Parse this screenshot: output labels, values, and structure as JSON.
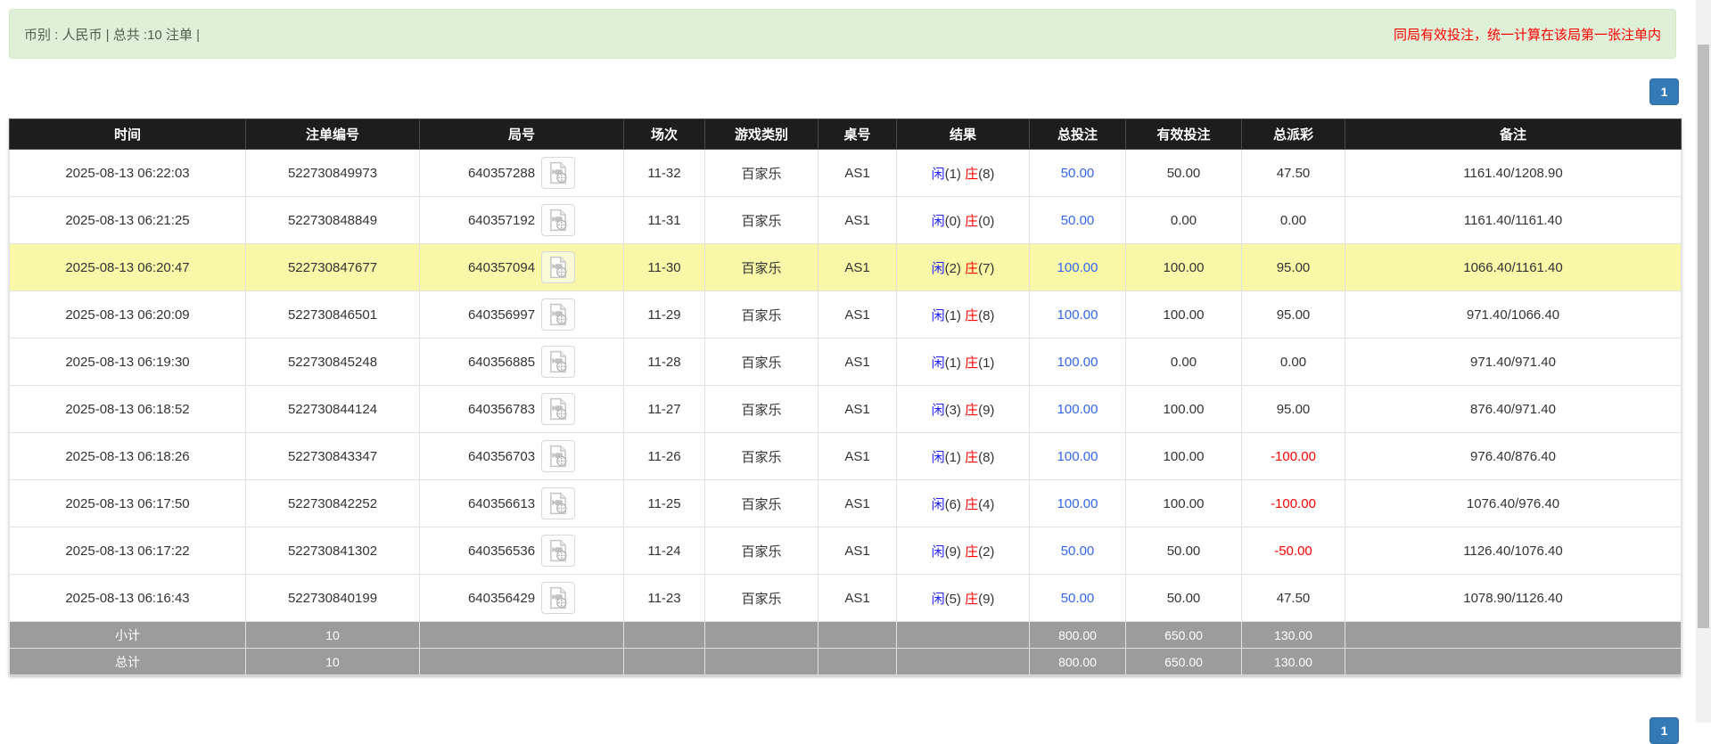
{
  "info_bar": {
    "left_text": "币别 : 人民币 | 总共 :10 注单 |",
    "right_text": "同局有效投注，统一计算在该局第一张注单内"
  },
  "pagination": {
    "page": "1"
  },
  "table": {
    "columns": [
      "时间",
      "注单编号",
      "局号",
      "场次",
      "游戏类别",
      "桌号",
      "结果",
      "总投注",
      "有效投注",
      "总派彩",
      "备注"
    ],
    "result_labels": {
      "player": "闲",
      "banker": "庄"
    },
    "video_icon": "video-replay-icon",
    "rows": [
      {
        "time": "2025-08-13 06:22:03",
        "bet_id": "522730849973",
        "round_id": "640357288",
        "session": "11-32",
        "game": "百家乐",
        "table_no": "AS1",
        "player": "1",
        "banker": "8",
        "total_bet": "50.00",
        "valid_bet": "50.00",
        "payout": "47.50",
        "remark": "1161.40/1208.90",
        "highlight": false
      },
      {
        "time": "2025-08-13 06:21:25",
        "bet_id": "522730848849",
        "round_id": "640357192",
        "session": "11-31",
        "game": "百家乐",
        "table_no": "AS1",
        "player": "0",
        "banker": "0",
        "total_bet": "50.00",
        "valid_bet": "0.00",
        "payout": "0.00",
        "remark": "1161.40/1161.40",
        "highlight": false
      },
      {
        "time": "2025-08-13 06:20:47",
        "bet_id": "522730847677",
        "round_id": "640357094",
        "session": "11-30",
        "game": "百家乐",
        "table_no": "AS1",
        "player": "2",
        "banker": "7",
        "total_bet": "100.00",
        "valid_bet": "100.00",
        "payout": "95.00",
        "remark": "1066.40/1161.40",
        "highlight": true
      },
      {
        "time": "2025-08-13 06:20:09",
        "bet_id": "522730846501",
        "round_id": "640356997",
        "session": "11-29",
        "game": "百家乐",
        "table_no": "AS1",
        "player": "1",
        "banker": "8",
        "total_bet": "100.00",
        "valid_bet": "100.00",
        "payout": "95.00",
        "remark": "971.40/1066.40",
        "highlight": false
      },
      {
        "time": "2025-08-13 06:19:30",
        "bet_id": "522730845248",
        "round_id": "640356885",
        "session": "11-28",
        "game": "百家乐",
        "table_no": "AS1",
        "player": "1",
        "banker": "1",
        "total_bet": "100.00",
        "valid_bet": "0.00",
        "payout": "0.00",
        "remark": "971.40/971.40",
        "highlight": false
      },
      {
        "time": "2025-08-13 06:18:52",
        "bet_id": "522730844124",
        "round_id": "640356783",
        "session": "11-27",
        "game": "百家乐",
        "table_no": "AS1",
        "player": "3",
        "banker": "9",
        "total_bet": "100.00",
        "valid_bet": "100.00",
        "payout": "95.00",
        "remark": "876.40/971.40",
        "highlight": false
      },
      {
        "time": "2025-08-13 06:18:26",
        "bet_id": "522730843347",
        "round_id": "640356703",
        "session": "11-26",
        "game": "百家乐",
        "table_no": "AS1",
        "player": "1",
        "banker": "8",
        "total_bet": "100.00",
        "valid_bet": "100.00",
        "payout": "-100.00",
        "remark": "976.40/876.40",
        "highlight": false
      },
      {
        "time": "2025-08-13 06:17:50",
        "bet_id": "522730842252",
        "round_id": "640356613",
        "session": "11-25",
        "game": "百家乐",
        "table_no": "AS1",
        "player": "6",
        "banker": "4",
        "total_bet": "100.00",
        "valid_bet": "100.00",
        "payout": "-100.00",
        "remark": "1076.40/976.40",
        "highlight": false
      },
      {
        "time": "2025-08-13 06:17:22",
        "bet_id": "522730841302",
        "round_id": "640356536",
        "session": "11-24",
        "game": "百家乐",
        "table_no": "AS1",
        "player": "9",
        "banker": "2",
        "total_bet": "50.00",
        "valid_bet": "50.00",
        "payout": "-50.00",
        "remark": "1126.40/1076.40",
        "highlight": false
      },
      {
        "time": "2025-08-13 06:16:43",
        "bet_id": "522730840199",
        "round_id": "640356429",
        "session": "11-23",
        "game": "百家乐",
        "table_no": "AS1",
        "player": "5",
        "banker": "9",
        "total_bet": "50.00",
        "valid_bet": "50.00",
        "payout": "47.50",
        "remark": "1078.90/1126.40",
        "highlight": false
      }
    ],
    "subtotal": {
      "label": "小计",
      "count": "10",
      "total_bet": "800.00",
      "valid_bet": "650.00",
      "payout": "130.00"
    },
    "total": {
      "label": "总计",
      "count": "10",
      "total_bet": "800.00",
      "valid_bet": "650.00",
      "payout": "130.00"
    }
  },
  "colors": {
    "info_bar_bg": "#dff0d8",
    "info_bar_border": "#d6e9c6",
    "alert_red": "#ff0000",
    "header_bg": "#1d1d1d",
    "highlight_row": "#f8f8a8",
    "totals_row_bg": "#9c9c9c",
    "pagination_blue": "#337ab7",
    "bet_link_blue": "#3366ee",
    "player_blue": "#2222ff",
    "banker_red": "#ff0000",
    "negative_red": "#ff0000"
  }
}
